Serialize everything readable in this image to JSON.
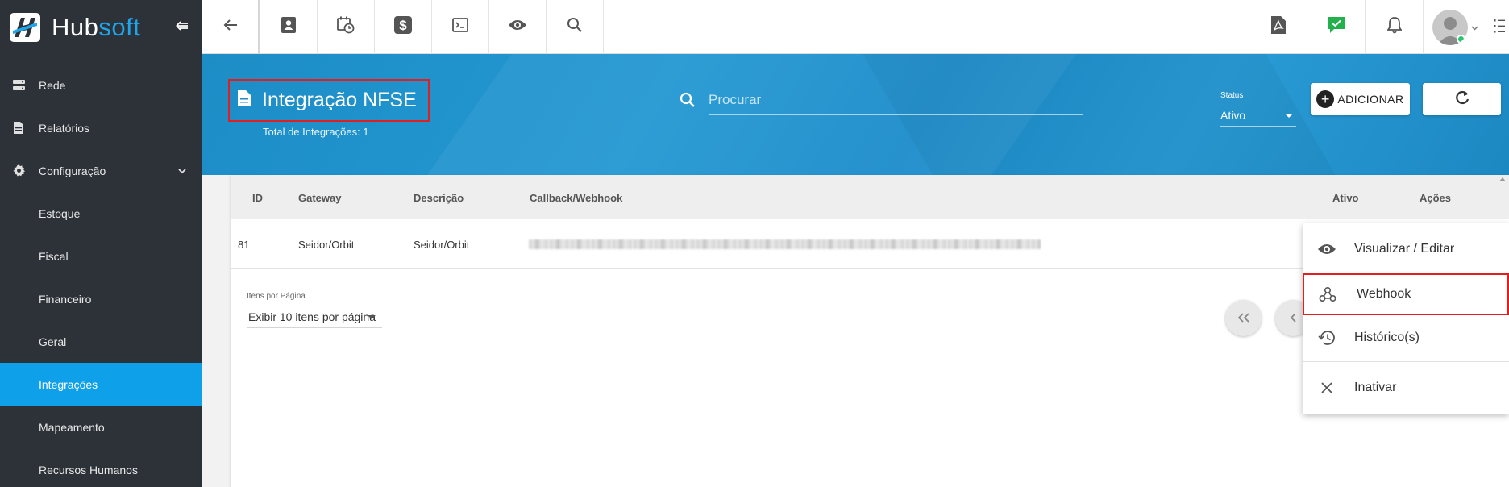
{
  "brand": {
    "name_part1": "Hub",
    "name_part2": "soft"
  },
  "sidebar": {
    "items": [
      {
        "label": "Rede",
        "icon": "server-icon"
      },
      {
        "label": "Relatórios",
        "icon": "document-icon"
      },
      {
        "label": "Configuração",
        "icon": "gear-icon",
        "expanded": true
      }
    ],
    "sub_items": [
      {
        "label": "Estoque"
      },
      {
        "label": "Fiscal"
      },
      {
        "label": "Financeiro"
      },
      {
        "label": "Geral"
      },
      {
        "label": "Integrações",
        "active": true
      },
      {
        "label": "Mapeamento"
      },
      {
        "label": "Recursos Humanos"
      }
    ]
  },
  "topbar": {
    "icons": [
      "back-arrow-icon",
      "contact-card-icon",
      "calendar-clock-icon",
      "dollar-icon",
      "terminal-icon",
      "eye-icon",
      "search-icon"
    ],
    "right_icons": [
      "pdf-icon",
      "chat-check-icon",
      "bell-icon",
      "user-avatar"
    ]
  },
  "header": {
    "title": "Integração NFSE",
    "subtitle": "Total de Integrações: 1",
    "search_placeholder": "Procurar",
    "status_label": "Status",
    "status_value": "Ativo",
    "add_label": "ADICIONAR"
  },
  "table": {
    "columns": [
      "ID",
      "Gateway",
      "Descrição",
      "Callback/Webhook",
      "Ativo",
      "Ações"
    ],
    "rows": [
      {
        "id": "81",
        "gateway": "Seidor/Orbit",
        "descricao": "Seidor/Orbit"
      }
    ],
    "items_per_page_label": "Itens por Página",
    "items_per_page_value": "Exibir 10 itens por página"
  },
  "actions_menu": {
    "items": [
      {
        "label": "Visualizar / Editar",
        "icon": "eye-icon"
      },
      {
        "label": "Webhook",
        "icon": "webhook-icon",
        "highlighted": true
      },
      {
        "label": "Histórico(s)",
        "icon": "history-icon"
      },
      {
        "label": "Inativar",
        "icon": "close-icon"
      }
    ]
  },
  "colors": {
    "sidebar_bg": "#2d3238",
    "active_item": "#0ea0e8",
    "hero_bg": "#1d8dc6",
    "highlight_border": "#e02020",
    "online_status": "#28c76f"
  }
}
